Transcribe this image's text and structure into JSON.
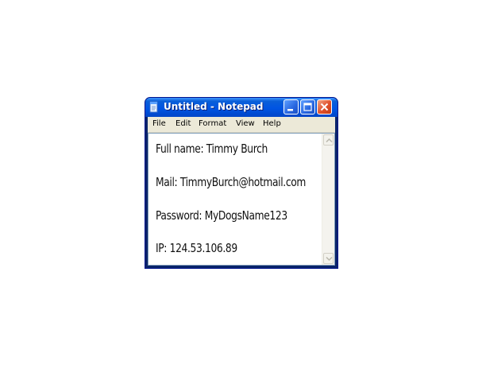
{
  "window": {
    "title": "Untitled - Notepad",
    "icon": "notepad-icon"
  },
  "title_controls": [
    "minimize-icon",
    "maximize-icon",
    "close-icon"
  ],
  "menu": {
    "items": [
      {
        "label": "File"
      },
      {
        "label": "Edit"
      },
      {
        "label": "Format"
      },
      {
        "label": "View"
      },
      {
        "label": "Help"
      }
    ]
  },
  "document": {
    "lines": [
      "Full name: Timmy Burch",
      "Mail: TimmyBurch@hotmail.com",
      "Password: MyDogsName123",
      "IP: 124.53.106.89"
    ]
  },
  "colors": {
    "titlebar": "#0054e3",
    "close_button": "#e0502a",
    "frame": "#ece9d8",
    "editor_bg": "#ffffff"
  }
}
